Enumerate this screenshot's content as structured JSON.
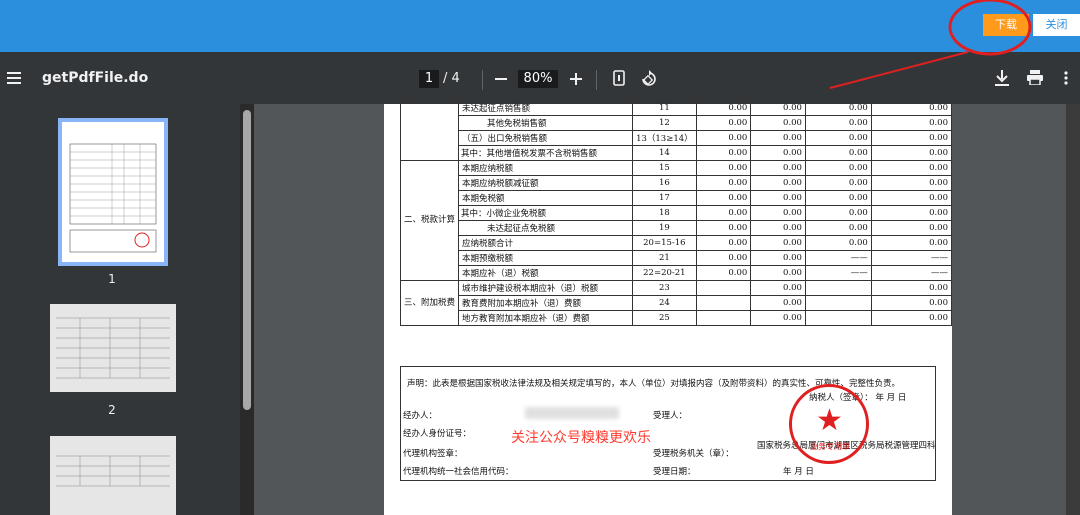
{
  "topbar": {
    "download_label": "下载",
    "close_label": "关闭"
  },
  "toolbar": {
    "filename": "getPdfFile.do",
    "current_page": "1",
    "page_sep": "/",
    "total_pages": "4",
    "zoom": "80%"
  },
  "sidebar": {
    "thumbs": [
      {
        "label": "1"
      },
      {
        "label": "2"
      }
    ]
  },
  "table": {
    "rows": [
      {
        "name": "未达起征点销售额",
        "idx": "11",
        "c1": "0.00",
        "c2": "0.00",
        "c3": "0.00",
        "c4": "0.00"
      },
      {
        "name": "其他免税销售额",
        "idx": "12",
        "c1": "0.00",
        "c2": "0.00",
        "c3": "0.00",
        "c4": "0.00"
      },
      {
        "name": "（五）出口免税销售额",
        "idx": "13（13≥14）",
        "c1": "0.00",
        "c2": "0.00",
        "c3": "0.00",
        "c4": "0.00"
      },
      {
        "name": "其中：其他增值税发票不含税销售额",
        "idx": "14",
        "c1": "0.00",
        "c2": "0.00",
        "c3": "0.00",
        "c4": "0.00"
      },
      {
        "name": "本期应纳税额",
        "idx": "15",
        "c1": "0.00",
        "c2": "0.00",
        "c3": "0.00",
        "c4": "0.00"
      },
      {
        "name": "本期应纳税额减征额",
        "idx": "16",
        "c1": "0.00",
        "c2": "0.00",
        "c3": "0.00",
        "c4": "0.00"
      },
      {
        "name": "本期免税额",
        "idx": "17",
        "c1": "0.00",
        "c2": "0.00",
        "c3": "0.00",
        "c4": "0.00"
      },
      {
        "name": "其中：小微企业免税额",
        "idx": "18",
        "c1": "0.00",
        "c2": "0.00",
        "c3": "0.00",
        "c4": "0.00"
      },
      {
        "name": "未达起征点免税额",
        "idx": "19",
        "c1": "0.00",
        "c2": "0.00",
        "c3": "0.00",
        "c4": "0.00"
      },
      {
        "name": "应纳税额合计",
        "idx": "20=15-16",
        "c1": "0.00",
        "c2": "0.00",
        "c3": "0.00",
        "c4": "0.00"
      },
      {
        "name": "本期预缴税额",
        "idx": "21",
        "c1": "0.00",
        "c2": "0.00",
        "c3": "——",
        "c4": "——"
      },
      {
        "name": "本期应补（退）税额",
        "idx": "22=20-21",
        "c1": "0.00",
        "c2": "0.00",
        "c3": "——",
        "c4": "——"
      },
      {
        "name": "城市维护建设税本期应补（退）税额",
        "idx": "23",
        "c1": "",
        "c2": "0.00",
        "c3": "",
        "c4": "0.00"
      },
      {
        "name": "教育费附加本期应补（退）费额",
        "idx": "24",
        "c1": "",
        "c2": "0.00",
        "c3": "",
        "c4": "0.00"
      },
      {
        "name": "地方教育附加本期应补（退）费额",
        "idx": "25",
        "c1": "",
        "c2": "0.00",
        "c3": "",
        "c4": "0.00"
      }
    ],
    "section2": "二、税款计算",
    "section3": "三、附加税费"
  },
  "declaration": {
    "statement": "声明：此表是根据国家税收法律法规及相关规定填写的，本人（单位）对填报内容（及附带资料）的真实性、可靠性、完整性负责。",
    "sign_date": "纳税人（签章）：  年  月  日",
    "agent": "经办人：",
    "agent_id": "经办人身份证号：",
    "agency_seal": "代理机构签章：",
    "agency_code": "代理机构统一社会信用代码：",
    "receiver": "受理人：",
    "tax_office": "受理税务机关（章）：",
    "tax_office_name": "国家税务总局厦门市湖里区税务局税源管理四科",
    "receive_date": "受理日期：",
    "date_parts": "年  月  日",
    "watermark": "关注公众号糗糗更欢乐",
    "seal_text": "业务专用章"
  },
  "colors": {
    "accent": "#2b8fde",
    "download": "#ff9a1a",
    "annotation": "#e02020"
  }
}
